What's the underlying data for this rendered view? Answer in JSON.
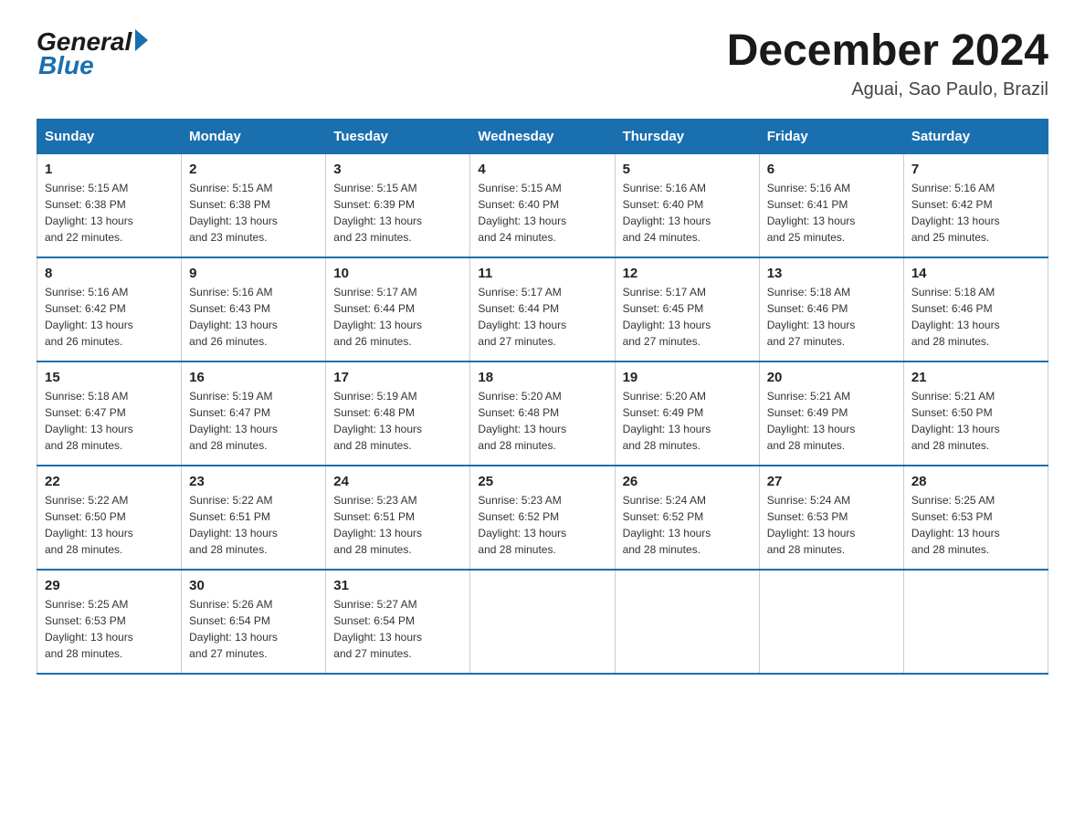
{
  "logo": {
    "general": "General",
    "blue": "Blue"
  },
  "header": {
    "month": "December 2024",
    "location": "Aguai, Sao Paulo, Brazil"
  },
  "days_of_week": [
    "Sunday",
    "Monday",
    "Tuesday",
    "Wednesday",
    "Thursday",
    "Friday",
    "Saturday"
  ],
  "weeks": [
    [
      {
        "day": "1",
        "sunrise": "5:15 AM",
        "sunset": "6:38 PM",
        "daylight": "13 hours and 22 minutes."
      },
      {
        "day": "2",
        "sunrise": "5:15 AM",
        "sunset": "6:38 PM",
        "daylight": "13 hours and 23 minutes."
      },
      {
        "day": "3",
        "sunrise": "5:15 AM",
        "sunset": "6:39 PM",
        "daylight": "13 hours and 23 minutes."
      },
      {
        "day": "4",
        "sunrise": "5:15 AM",
        "sunset": "6:40 PM",
        "daylight": "13 hours and 24 minutes."
      },
      {
        "day": "5",
        "sunrise": "5:16 AM",
        "sunset": "6:40 PM",
        "daylight": "13 hours and 24 minutes."
      },
      {
        "day": "6",
        "sunrise": "5:16 AM",
        "sunset": "6:41 PM",
        "daylight": "13 hours and 25 minutes."
      },
      {
        "day": "7",
        "sunrise": "5:16 AM",
        "sunset": "6:42 PM",
        "daylight": "13 hours and 25 minutes."
      }
    ],
    [
      {
        "day": "8",
        "sunrise": "5:16 AM",
        "sunset": "6:42 PM",
        "daylight": "13 hours and 26 minutes."
      },
      {
        "day": "9",
        "sunrise": "5:16 AM",
        "sunset": "6:43 PM",
        "daylight": "13 hours and 26 minutes."
      },
      {
        "day": "10",
        "sunrise": "5:17 AM",
        "sunset": "6:44 PM",
        "daylight": "13 hours and 26 minutes."
      },
      {
        "day": "11",
        "sunrise": "5:17 AM",
        "sunset": "6:44 PM",
        "daylight": "13 hours and 27 minutes."
      },
      {
        "day": "12",
        "sunrise": "5:17 AM",
        "sunset": "6:45 PM",
        "daylight": "13 hours and 27 minutes."
      },
      {
        "day": "13",
        "sunrise": "5:18 AM",
        "sunset": "6:46 PM",
        "daylight": "13 hours and 27 minutes."
      },
      {
        "day": "14",
        "sunrise": "5:18 AM",
        "sunset": "6:46 PM",
        "daylight": "13 hours and 28 minutes."
      }
    ],
    [
      {
        "day": "15",
        "sunrise": "5:18 AM",
        "sunset": "6:47 PM",
        "daylight": "13 hours and 28 minutes."
      },
      {
        "day": "16",
        "sunrise": "5:19 AM",
        "sunset": "6:47 PM",
        "daylight": "13 hours and 28 minutes."
      },
      {
        "day": "17",
        "sunrise": "5:19 AM",
        "sunset": "6:48 PM",
        "daylight": "13 hours and 28 minutes."
      },
      {
        "day": "18",
        "sunrise": "5:20 AM",
        "sunset": "6:48 PM",
        "daylight": "13 hours and 28 minutes."
      },
      {
        "day": "19",
        "sunrise": "5:20 AM",
        "sunset": "6:49 PM",
        "daylight": "13 hours and 28 minutes."
      },
      {
        "day": "20",
        "sunrise": "5:21 AM",
        "sunset": "6:49 PM",
        "daylight": "13 hours and 28 minutes."
      },
      {
        "day": "21",
        "sunrise": "5:21 AM",
        "sunset": "6:50 PM",
        "daylight": "13 hours and 28 minutes."
      }
    ],
    [
      {
        "day": "22",
        "sunrise": "5:22 AM",
        "sunset": "6:50 PM",
        "daylight": "13 hours and 28 minutes."
      },
      {
        "day": "23",
        "sunrise": "5:22 AM",
        "sunset": "6:51 PM",
        "daylight": "13 hours and 28 minutes."
      },
      {
        "day": "24",
        "sunrise": "5:23 AM",
        "sunset": "6:51 PM",
        "daylight": "13 hours and 28 minutes."
      },
      {
        "day": "25",
        "sunrise": "5:23 AM",
        "sunset": "6:52 PM",
        "daylight": "13 hours and 28 minutes."
      },
      {
        "day": "26",
        "sunrise": "5:24 AM",
        "sunset": "6:52 PM",
        "daylight": "13 hours and 28 minutes."
      },
      {
        "day": "27",
        "sunrise": "5:24 AM",
        "sunset": "6:53 PM",
        "daylight": "13 hours and 28 minutes."
      },
      {
        "day": "28",
        "sunrise": "5:25 AM",
        "sunset": "6:53 PM",
        "daylight": "13 hours and 28 minutes."
      }
    ],
    [
      {
        "day": "29",
        "sunrise": "5:25 AM",
        "sunset": "6:53 PM",
        "daylight": "13 hours and 28 minutes."
      },
      {
        "day": "30",
        "sunrise": "5:26 AM",
        "sunset": "6:54 PM",
        "daylight": "13 hours and 27 minutes."
      },
      {
        "day": "31",
        "sunrise": "5:27 AM",
        "sunset": "6:54 PM",
        "daylight": "13 hours and 27 minutes."
      },
      null,
      null,
      null,
      null
    ]
  ],
  "labels": {
    "sunrise": "Sunrise:",
    "sunset": "Sunset:",
    "daylight": "Daylight:"
  }
}
